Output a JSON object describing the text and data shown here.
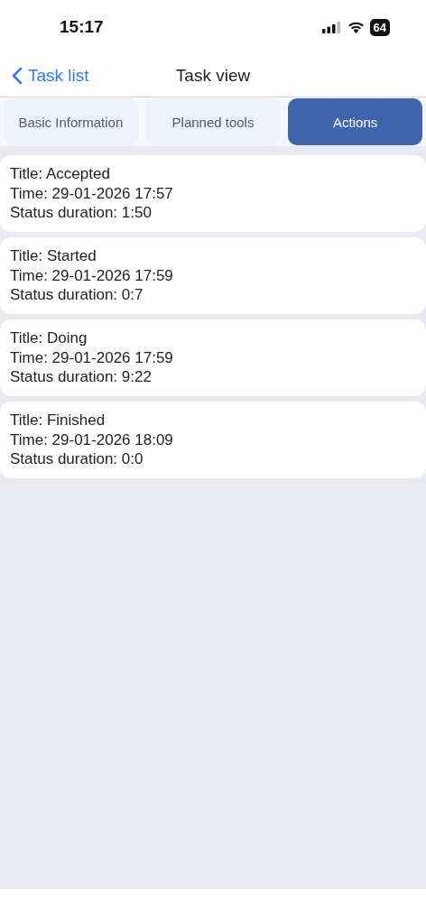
{
  "status_bar": {
    "time": "15:17",
    "battery": "64"
  },
  "nav": {
    "back": "Task list",
    "title": "Task view"
  },
  "tabs": [
    {
      "label": "Basic Information",
      "selected": false
    },
    {
      "label": "Planned tools",
      "selected": false
    },
    {
      "label": "Actions",
      "selected": true
    }
  ],
  "actions": [
    {
      "lines": [
        "Title: Accepted",
        "Time: 29-01-2026 17:57",
        "Status duration: 1:50"
      ]
    },
    {
      "lines": [
        "Title: Started",
        "Time: 29-01-2026 17:59",
        "Status duration: 0:7"
      ]
    },
    {
      "lines": [
        "Title: Doing",
        "Time: 29-01-2026 17:59",
        "Status duration: 9:22"
      ]
    },
    {
      "lines": [
        "Title: Finished",
        "Time: 29-01-2026 18:09",
        "Status duration: 0:0"
      ]
    }
  ]
}
